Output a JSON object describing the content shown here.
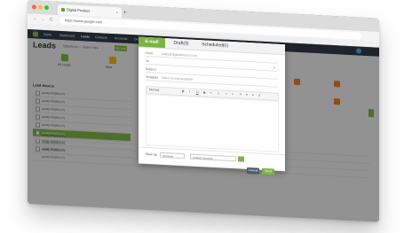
{
  "browser": {
    "tab_title": "Digital Product",
    "tab_close": "×",
    "new_tab": "+",
    "url": "https://www.google.com",
    "nav_back": "←",
    "nav_forward": "→",
    "nav_reload": "C"
  },
  "app": {
    "page_title": "Leads",
    "breadcrumb": "Salesforce — Select View",
    "add_button": "Add Lead",
    "topnav": [
      "Home",
      "Dashboard",
      "Leads",
      "Contacts",
      "Accounts",
      "Deals"
    ],
    "stats": [
      {
        "label": "All Leads",
        "color": "#7cb342"
      },
      {
        "label": "New",
        "color": "#f2b705"
      }
    ],
    "list_heading": "Lead Source",
    "list_items": [
      "ACME PRODUCTS",
      "ACME PRODUCTS",
      "ACME PRODUCTS",
      "ACME PRODUCTS",
      "ACME PRODUCTS",
      "ACME PRODUCTS",
      "ACME PRODUCTS",
      "ACME PRODUCTS"
    ],
    "selected_index": 5,
    "low_rows": [
      "ACME PRODUCTS",
      "ACME PRODUCTS",
      "ACME PRODUCTS",
      "ACME PRODUCTS"
    ],
    "right_icons": [
      {
        "color": "#e67e22"
      },
      {
        "color": "#e67e22"
      },
      {
        "color": "#e67e22"
      }
    ]
  },
  "modal": {
    "tabs": [
      "E-mail",
      "Draft(3)",
      "Scheduled(0)"
    ],
    "active_tab": 0,
    "from_label": "From",
    "from_value": "sales@digitalproduct.com",
    "to_label": "To",
    "subject_label": "Subject",
    "template_label": "Template",
    "template_value": "Select E-mail template",
    "toolbar_items": [
      "Normal",
      "B",
      "I",
      "U",
      "S",
      "•",
      "1.",
      "«",
      "»",
      "≡",
      "≡",
      "≡",
      "≡"
    ],
    "footer_label": "Save as",
    "footer_select": "Template",
    "footer_input": "Untitled template",
    "cancel": "Cancel",
    "send": "Send"
  },
  "colors": {
    "accent": "#7cb342",
    "nav": "#2f3b46",
    "cancel": "#4a5a69"
  }
}
